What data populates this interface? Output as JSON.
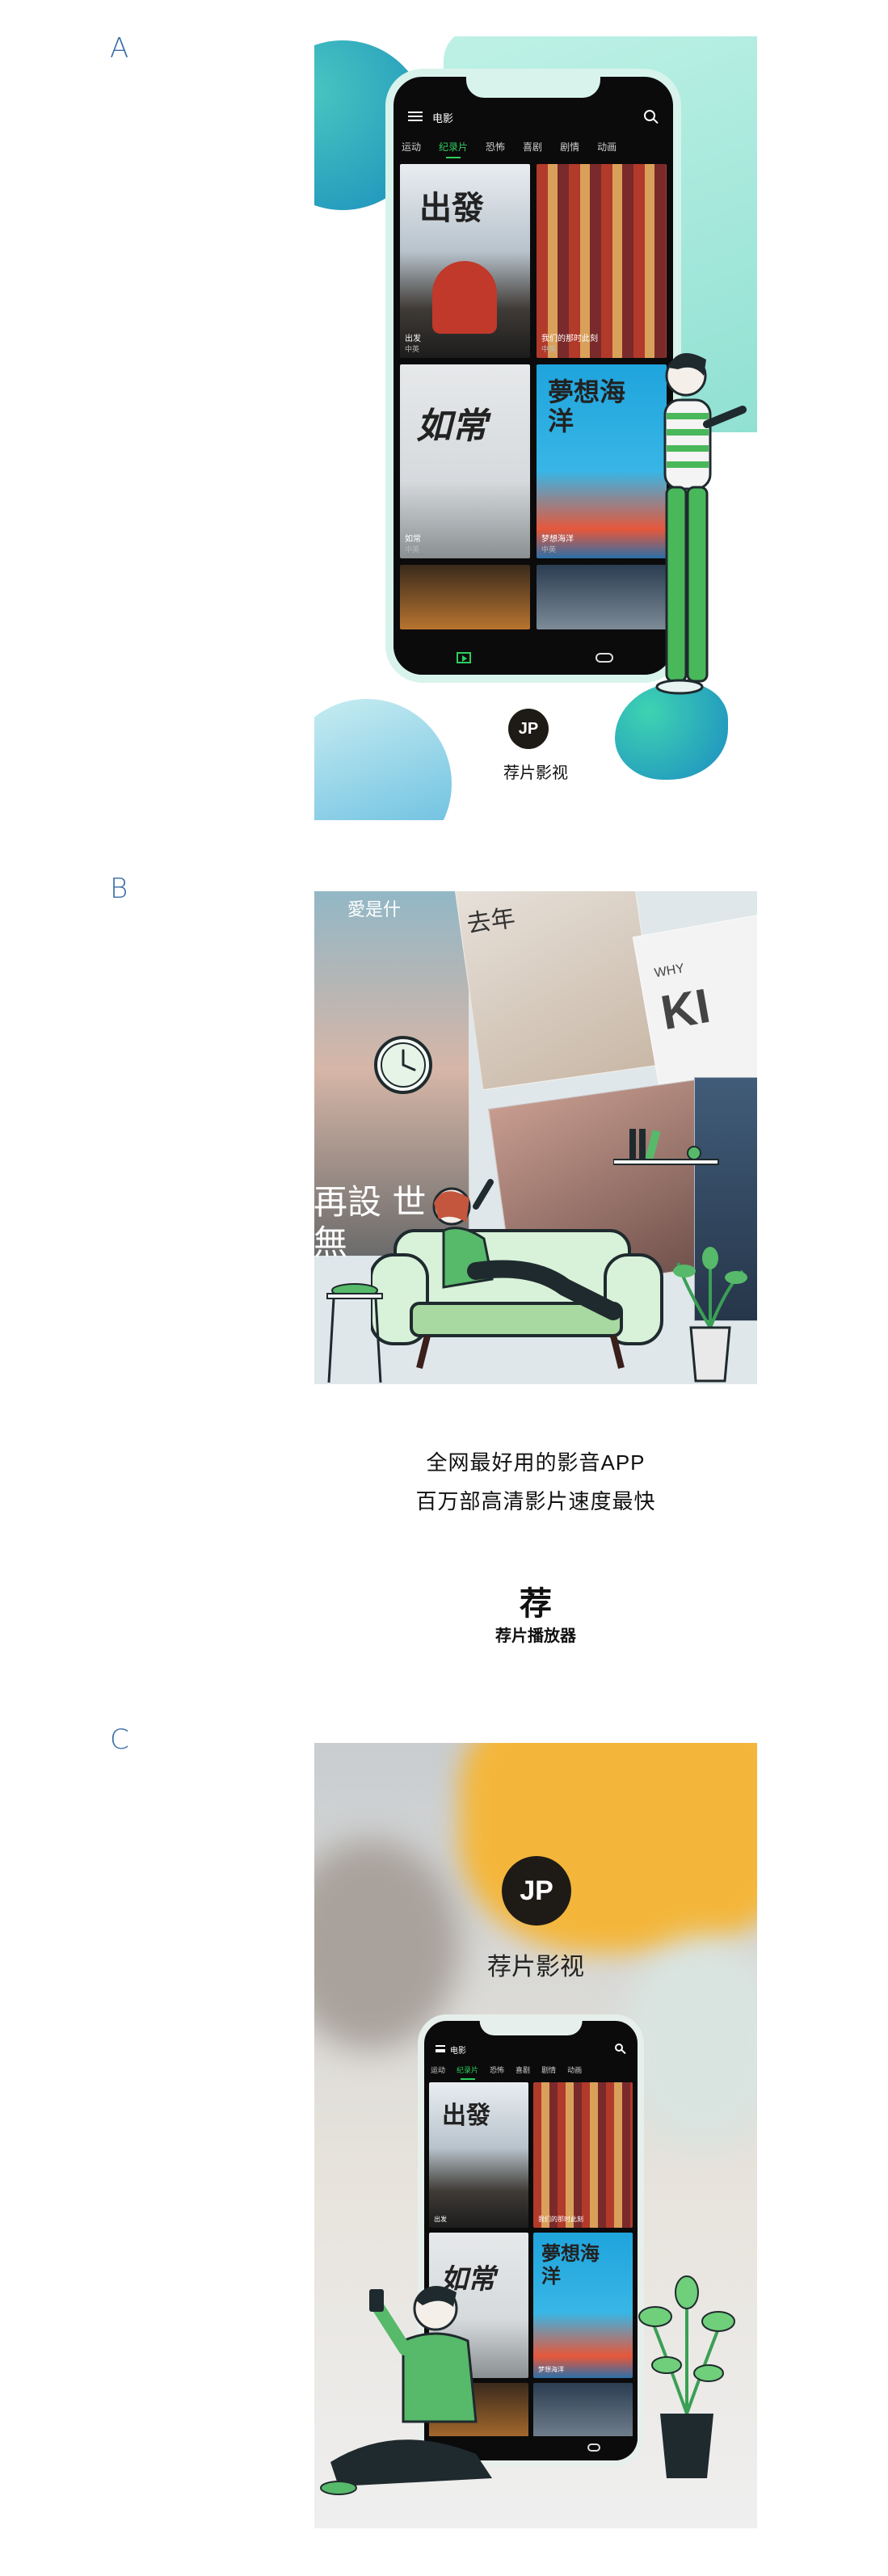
{
  "sections": {
    "a_label": "A",
    "b_label": "B",
    "c_label": "C"
  },
  "app": {
    "header_title": "电影",
    "tabs": [
      "运动",
      "纪录片",
      "恐怖",
      "喜剧",
      "剧情",
      "动画"
    ],
    "active_tab": "纪录片",
    "movies": [
      {
        "title": "出發",
        "caption": "出发",
        "sub": "中英"
      },
      {
        "title": "",
        "caption": "我们的那时此刻",
        "sub": "中英"
      },
      {
        "title": "如常",
        "caption": "如常",
        "sub": "中英"
      },
      {
        "title": "夢想海洋",
        "caption": "梦想海洋",
        "sub": "中英"
      },
      {
        "title": "",
        "caption": "",
        "sub": ""
      },
      {
        "title": "",
        "caption": "",
        "sub": ""
      }
    ]
  },
  "brand": {
    "name": "荐片影视",
    "glyph": "荐",
    "player_name": "荐片播放器",
    "logo_letter": "JP"
  },
  "panel_b": {
    "tagline_1": "全网最好用的影音APP",
    "tagline_2": "百万部高清影片速度最快",
    "poster_texts": [
      "愛是什",
      "去年",
      "WHY",
      "KI",
      "再設 世",
      "無"
    ]
  },
  "colors": {
    "accent_green": "#2ecf5d",
    "mint": "#a8e9dc",
    "teal_blue": "#1a9fc9",
    "dark": "#1e1b17"
  }
}
